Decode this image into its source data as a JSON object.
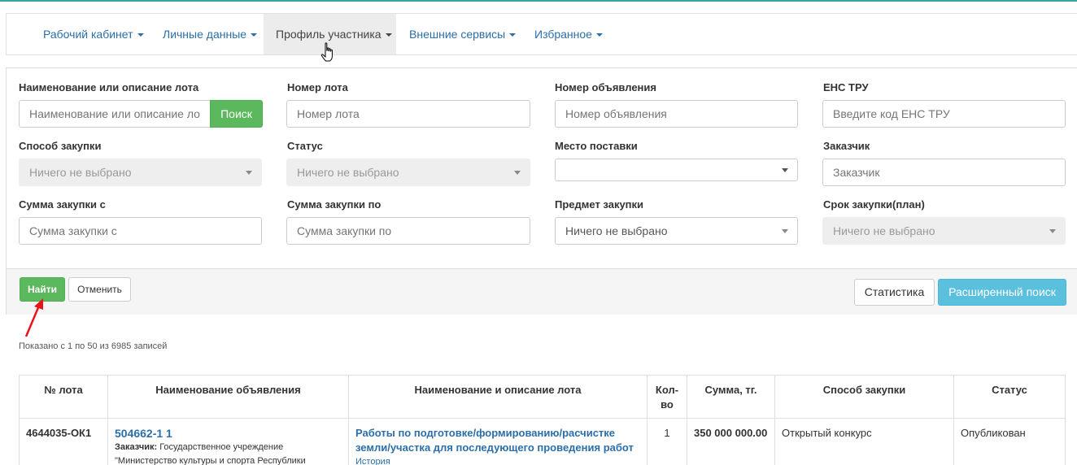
{
  "nav": {
    "items": [
      {
        "label": "Рабочий кабинет"
      },
      {
        "label": "Личные данные"
      },
      {
        "label": "Профиль участника"
      },
      {
        "label": "Внешние сервисы"
      },
      {
        "label": "Избранное"
      }
    ]
  },
  "filters": {
    "lot_name": {
      "label": "Наименование или описание лота",
      "placeholder": "Наименование или описание лота"
    },
    "search_button": "Поиск",
    "lot_number": {
      "label": "Номер лота",
      "placeholder": "Номер лота"
    },
    "announcement_number": {
      "label": "Номер объявления",
      "placeholder": "Номер объявления"
    },
    "ens_tru": {
      "label": "ЕНС ТРУ",
      "placeholder": "Введите код ЕНС ТРУ"
    },
    "purchase_method": {
      "label": "Способ закупки",
      "value": "Ничего не выбрано"
    },
    "status": {
      "label": "Статус",
      "value": "Ничего не выбрано"
    },
    "delivery_place": {
      "label": "Место поставки",
      "value": ""
    },
    "customer": {
      "label": "Заказчик",
      "placeholder": "Заказчик"
    },
    "sum_from": {
      "label": "Сумма закупки с",
      "placeholder": "Сумма закупки с"
    },
    "sum_to": {
      "label": "Сумма закупки по",
      "placeholder": "Сумма закупки по"
    },
    "subject": {
      "label": "Предмет закупки",
      "value": "Ничего не выбрано"
    },
    "term": {
      "label": "Срок закупки(план)",
      "value": "Ничего не выбрано"
    }
  },
  "actions": {
    "find": "Найти",
    "cancel": "Отменить",
    "statistics": "Статистика",
    "advanced_search": "Расширенный поиск"
  },
  "results_info": "Показано с 1 по 50 из 6985 записей",
  "table": {
    "headers": {
      "lot_no": "№ лота",
      "announcement": "Наименование объявления",
      "lot_desc": "Наименование и описание лота",
      "qty": "Кол-во",
      "sum": "Сумма, тг.",
      "method": "Способ закупки",
      "status": "Статус"
    },
    "rows": [
      {
        "lot_no": "4644035-ОК1",
        "announcement_link": "504662-1 1",
        "customer_label": "Заказчик:",
        "customer_text": "Государственное учреждение \"Министерство культуры и спорта Республики",
        "lot_desc_line1": "Работы по подготовке/формированию/расчистке",
        "lot_desc_line2": "земли/участка для последующего проведения работ",
        "history_link": "История",
        "qty": "1",
        "sum": "350 000 000.00",
        "method": "Открытый конкурс",
        "status": "Опубликован"
      }
    ]
  },
  "colors": {
    "link": "#2b6ea8",
    "success": "#5cb85c",
    "info": "#5bc0de",
    "annotation_arrow": "#e8141b"
  }
}
